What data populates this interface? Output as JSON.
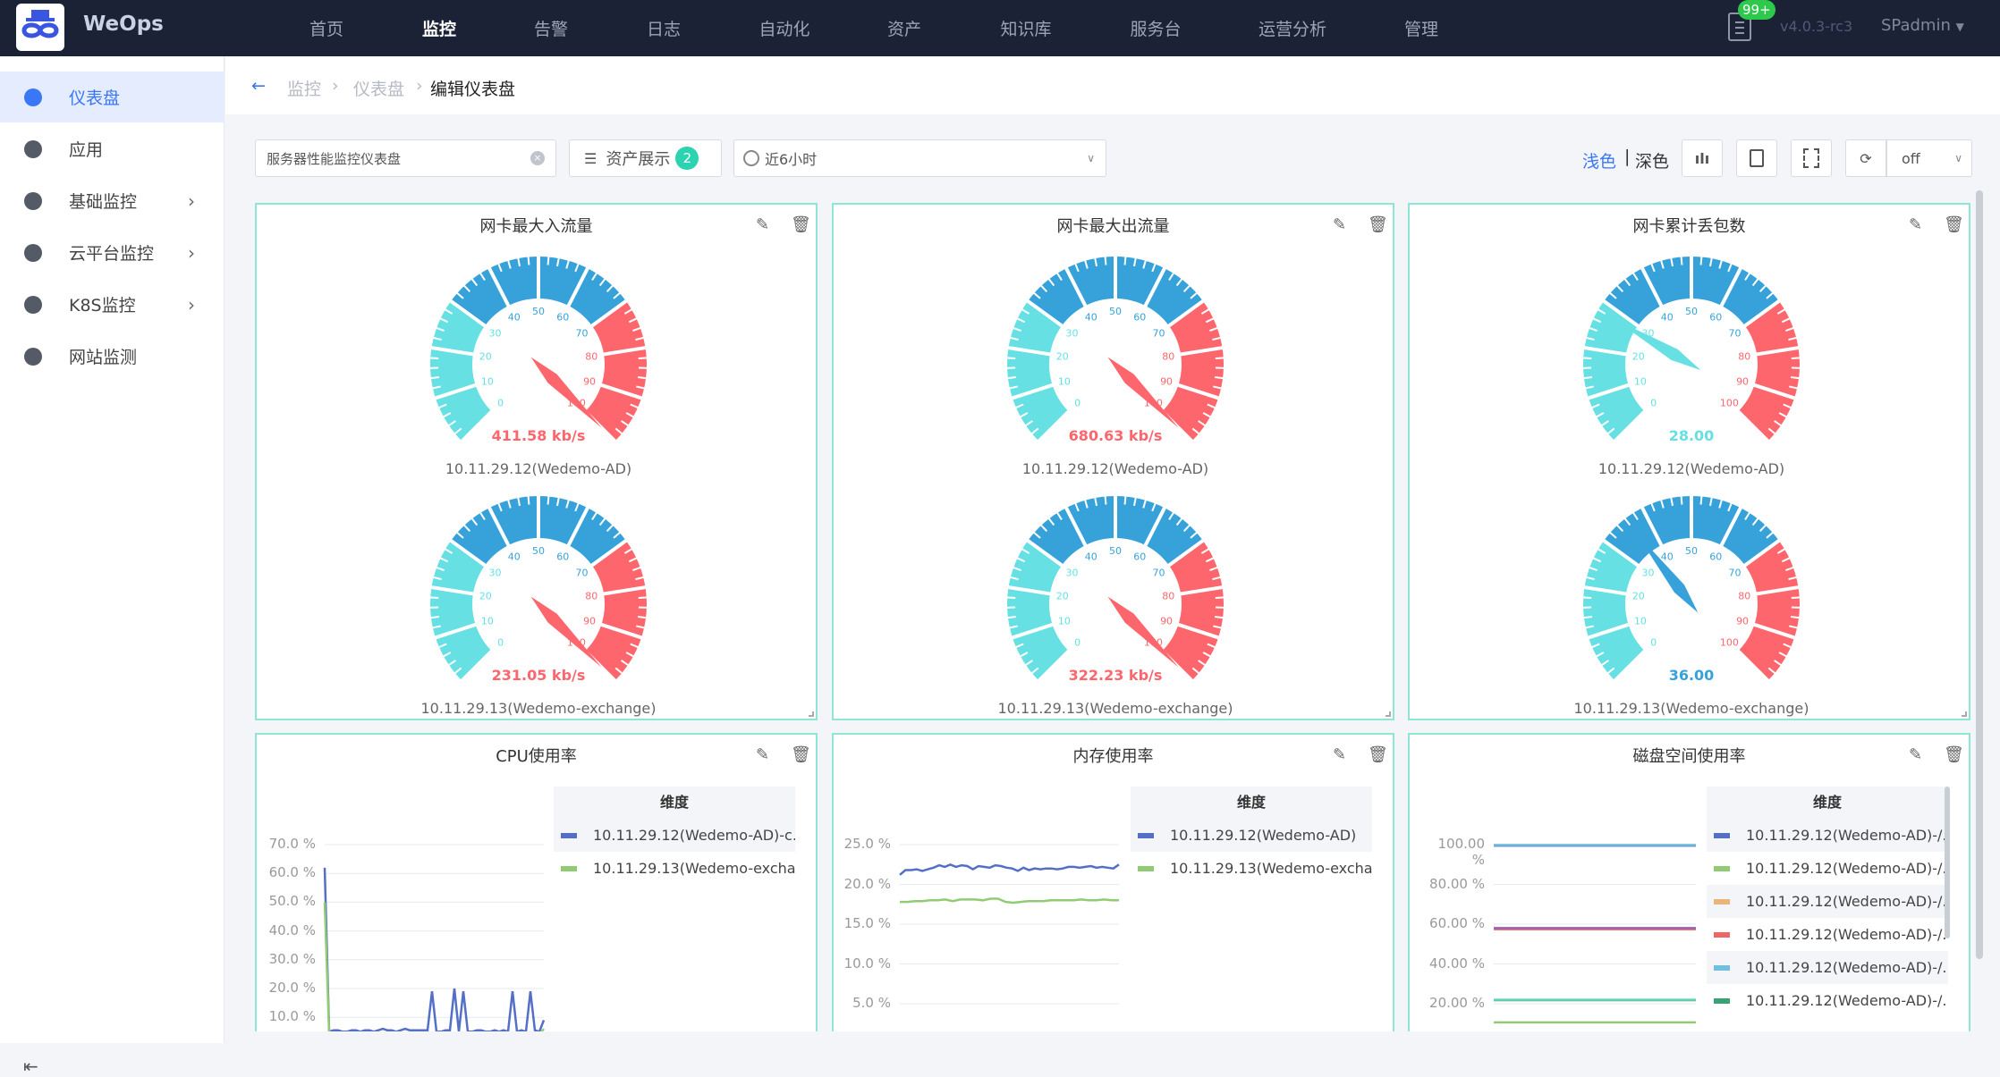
{
  "app": {
    "brand": "WeOps",
    "version": "v4.0.3-rc3",
    "user": "SPadmin",
    "notification_count": "99+"
  },
  "nav": [
    "首页",
    "监控",
    "告警",
    "日志",
    "自动化",
    "资产",
    "知识库",
    "服务台",
    "运营分析",
    "管理"
  ],
  "nav_active": 1,
  "sidebar": {
    "items": [
      {
        "label": "仪表盘",
        "icon": "dashboard-icon"
      },
      {
        "label": "应用",
        "icon": "apps-icon"
      },
      {
        "label": "基础监控",
        "icon": "webcam-icon",
        "expandable": true
      },
      {
        "label": "云平台监控",
        "icon": "cloud-icon",
        "expandable": true
      },
      {
        "label": "K8S监控",
        "icon": "cluster-icon",
        "expandable": true
      },
      {
        "label": "网站监测",
        "icon": "globe-icon"
      }
    ],
    "active": 0
  },
  "breadcrumb": [
    "监控",
    "仪表盘",
    "编辑仪表盘"
  ],
  "toolbar": {
    "dashboard_name": "服务器性能监控仪表盘",
    "asset_label": "资产展示",
    "asset_count": "2",
    "time_range": "近6小时",
    "theme_light": "浅色",
    "theme_dark": "深色",
    "refresh": "off"
  },
  "colors": {
    "accent": "#3a77f6",
    "gauge_low": "#67e0e3",
    "gauge_mid": "#37a2da",
    "gauge_high": "#fd666d"
  },
  "gauge_panels": [
    {
      "title": "网卡最大入流量",
      "gauges": [
        {
          "value": 411.58,
          "display": "411.58  kb/s",
          "label": "10.11.29.12(Wedemo-AD)"
        },
        {
          "value": 231.05,
          "display": "231.05  kb/s",
          "label": "10.11.29.13(Wedemo-exchange)"
        }
      ]
    },
    {
      "title": "网卡最大出流量",
      "gauges": [
        {
          "value": 680.63,
          "display": "680.63  kb/s",
          "label": "10.11.29.12(Wedemo-AD)"
        },
        {
          "value": 322.23,
          "display": "322.23  kb/s",
          "label": "10.11.29.13(Wedemo-exchange)"
        }
      ]
    },
    {
      "title": "网卡累计丢包数",
      "gauges": [
        {
          "value": 28,
          "display": "28.00",
          "label": "10.11.29.12(Wedemo-AD)"
        },
        {
          "value": 36,
          "display": "36.00",
          "label": "10.11.29.13(Wedemo-exchange)"
        }
      ]
    }
  ],
  "gauge_scale": {
    "min": 0,
    "max": 100,
    "labels": [
      "0",
      "10",
      "20",
      "30",
      "40",
      "50",
      "60",
      "70",
      "80",
      "90",
      "100"
    ]
  },
  "legend_header": "维度",
  "chart_data": [
    {
      "type": "line",
      "title": "CPU使用率",
      "ylim": [
        0,
        70
      ],
      "yticks": [
        "70.0 %",
        "60.0 %",
        "50.0 %",
        "40.0 %",
        "30.0 %",
        "20.0 %",
        "10.0 %"
      ],
      "ytick_values": [
        70,
        60,
        50,
        40,
        30,
        20,
        10
      ],
      "series": [
        {
          "name": "10.11.29.12(Wedemo-AD)-c...",
          "color": "#5470c6",
          "values": [
            62,
            5,
            5.5,
            5.5,
            5,
            5,
            5.5,
            5.5,
            5,
            5.5,
            5.5,
            5,
            5.5,
            6,
            5.5,
            5.5,
            5,
            5.5,
            6,
            5.5,
            5.5,
            5.5,
            5.5,
            5.5,
            19,
            5,
            5,
            5.5,
            5.5,
            20,
            5,
            19,
            5,
            5,
            5.5,
            5.5,
            5,
            5,
            5.5,
            5,
            5.5,
            5,
            19,
            5,
            5.5,
            5,
            19,
            5.5,
            5,
            9
          ]
        },
        {
          "name": "10.11.29.13(Wedemo-excha...",
          "color": "#91cc75",
          "values": [
            50,
            4,
            4,
            4.5,
            4,
            4,
            4.5,
            4,
            4,
            4.5,
            4,
            4,
            4,
            4.5,
            4,
            4,
            4,
            4,
            4.5,
            4,
            4,
            4,
            4,
            4,
            4,
            4,
            4,
            4.5,
            4,
            4,
            4,
            4,
            4,
            4,
            4,
            4,
            4,
            4.5,
            4,
            4,
            4,
            4,
            4,
            4,
            4,
            4,
            4,
            4,
            4,
            6
          ]
        }
      ]
    },
    {
      "type": "line",
      "title": "内存使用率",
      "ylim": [
        0,
        25
      ],
      "yticks": [
        "25.0 %",
        "20.0 %",
        "15.0 %",
        "10.0 %",
        "5.0 %"
      ],
      "ytick_values": [
        25,
        20,
        15,
        10,
        5
      ],
      "series": [
        {
          "name": "10.11.29.12(Wedemo-AD)",
          "color": "#5470c6",
          "values": [
            21.2,
            21.8,
            21.8,
            21.9,
            21.7,
            21.9,
            22.1,
            22.4,
            22.2,
            22.5,
            22.2,
            22.4,
            22.3,
            21.9,
            22.3,
            22.2,
            22.1,
            22.4,
            22.3,
            22.1,
            22.0,
            21.7,
            22.1,
            21.8,
            22.0,
            21.9,
            22.0,
            22.0,
            21.9,
            22.0,
            22.2,
            22.2,
            22.1,
            22.2,
            22.3,
            22.1,
            22.2,
            22.1,
            22.0,
            22.5
          ]
        },
        {
          "name": "10.11.29.13(Wedemo-excha...",
          "color": "#91cc75",
          "values": [
            17.8,
            17.8,
            17.9,
            17.9,
            18.0,
            18.0,
            18.1,
            17.9,
            18.1,
            18.1,
            18.1,
            18.0,
            18.2,
            18.2,
            17.8,
            17.7,
            17.8,
            17.9,
            17.9,
            17.9,
            18.0,
            18.0,
            18.0,
            18.0,
            18.1,
            18.0,
            18.0,
            18.1,
            18.0,
            18.0
          ]
        }
      ]
    },
    {
      "type": "line",
      "title": "磁盘空间使用率",
      "ylim": [
        0,
        100
      ],
      "yticks": [
        "100.00 %",
        "80.00 %",
        "60.00 %",
        "40.00 %",
        "20.00 %"
      ],
      "ytick_values": [
        100,
        80,
        60,
        40,
        20
      ],
      "series": [
        {
          "name": "10.11.29.12(Wedemo-AD)-/...",
          "color": "#5470c6",
          "values": [
            99.5,
            99.5
          ]
        },
        {
          "name": "10.11.29.12(Wedemo-AD)-/...",
          "color": "#91cc75",
          "values": [
            10.6,
            10.6
          ]
        },
        {
          "name": "10.11.29.12(Wedemo-AD)-/...",
          "color": "#e8b57a",
          "values": [
            57.8,
            57.8
          ]
        },
        {
          "name": "10.11.29.12(Wedemo-AD)-/...",
          "color": "#ee6666",
          "values": [
            57.5,
            57.5
          ]
        },
        {
          "name": "10.11.29.12(Wedemo-AD)-/...",
          "color": "#73c0de",
          "values": [
            99.8,
            99.8
          ]
        },
        {
          "name": "10.11.29.12(Wedemo-AD)-/...",
          "color": "#3ba272",
          "values": [
            21.8,
            21.8
          ]
        },
        {
          "name": "",
          "color": "#9a60b4",
          "values": [
            58,
            58
          ]
        },
        {
          "name": "",
          "color": "#5fd3b5",
          "values": [
            22,
            22
          ]
        }
      ]
    }
  ]
}
